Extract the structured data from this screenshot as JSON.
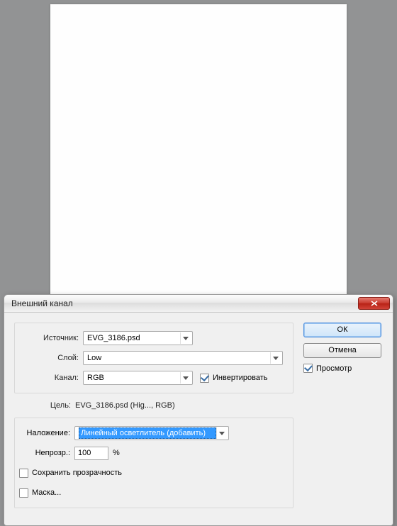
{
  "dialog": {
    "title": "Внешний канал",
    "labels": {
      "source": "Источник:",
      "layer": "Слой:",
      "channel": "Канал:",
      "invert": "Инвертировать",
      "target": "Цель:",
      "blending": "Наложение:",
      "opacity": "Непрозр.:",
      "preserve": "Сохранить прозрачность",
      "mask": "Маска..."
    },
    "values": {
      "source": "EVG_3186.psd",
      "layer": "Low",
      "channel": "RGB",
      "invert_checked": true,
      "target": "EVG_3186.psd (Hig..., RGB)",
      "blending": "Линейный осветлитель (добавить)",
      "opacity": "100",
      "opacity_unit": "%",
      "preserve_checked": false,
      "mask_checked": false
    },
    "buttons": {
      "ok": "ОК",
      "cancel": "Отмена",
      "preview": "Просмотр",
      "preview_checked": true
    }
  }
}
